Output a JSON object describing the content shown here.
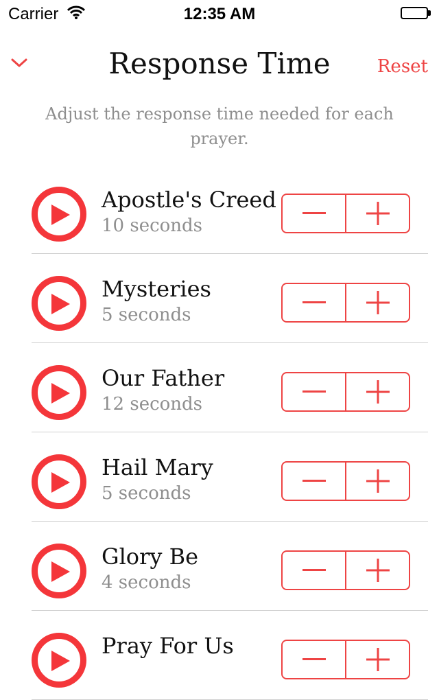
{
  "status_bar": {
    "carrier": "Carrier",
    "time": "12:35 AM"
  },
  "nav": {
    "title": "Response Time",
    "reset_label": "Reset"
  },
  "subtitle": "Adjust the response time needed for each prayer.",
  "accent_color": "#ee4444",
  "prayers": [
    {
      "name": "Apostle's Creed",
      "duration": "10 seconds"
    },
    {
      "name": "Mysteries",
      "duration": "5 seconds"
    },
    {
      "name": "Our Father",
      "duration": "12 seconds"
    },
    {
      "name": "Hail Mary",
      "duration": "5 seconds"
    },
    {
      "name": "Glory Be",
      "duration": "4 seconds"
    },
    {
      "name": "Pray For Us",
      "duration": ""
    }
  ]
}
